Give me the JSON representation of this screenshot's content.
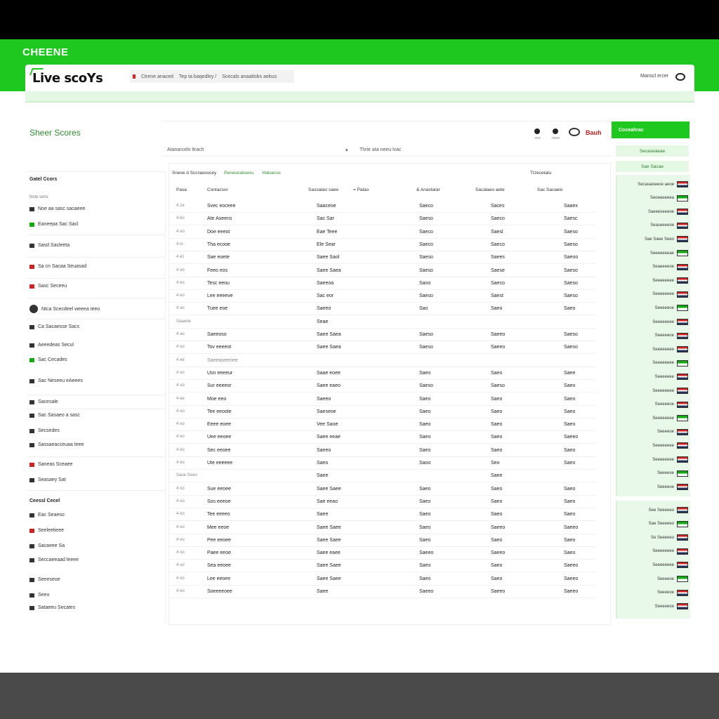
{
  "app": {
    "band_title": "CHEENE",
    "logo": "Live scoYs"
  },
  "top_links": [
    "Ctrene anaced",
    "Tep ta baqedley /",
    "Scecals anaatlobs aebus"
  ],
  "top_right": {
    "label": "Manscl ercer"
  },
  "main": {
    "title": "Sheer Scores",
    "icon_labels": [
      "-cee",
      "-neec"
    ],
    "brand": "Bauh",
    "filter": {
      "left": "Atanarcelo ltrach",
      "right": "Thrie ata neeu lvac"
    },
    "cta": "Coceahrac",
    "tabs": [
      "Sneve d Sccraeoocey",
      "Peneunatsenu",
      "Halsecsc"
    ],
    "tab_right": "Trzecetalu",
    "columns": [
      "Pasa",
      "Contacsor",
      "Sassatao saee",
      "= Palao",
      "& Anastatar",
      "Sacalaeo aete",
      "Sac Sacaeio"
    ]
  },
  "left": {
    "head": "Gatel Ccors",
    "sub": "Ncte sens",
    "items": [
      "Noe aa sasc sacaeee",
      "Eaneepa Sac Sacl",
      "Sasd Sacleeta",
      "Sa cn Sacaa Seuasad",
      "Sasc Seceeu",
      "Ntca Scecdeel weeea   teeo",
      "Ca Sacaesse Sacs",
      "Aeeedeas Secul",
      "Sac Cecades",
      "Sac Neseeu eAeees",
      "Sacesale",
      "Sac Sasaeo a sasc",
      "Secsedes",
      "Sassaeacceuaa teee",
      "Saneas Sceaee",
      "Seasaey Sat"
    ],
    "head2": "Ceessl Cecel",
    "items2": [
      "Eac Seaeso",
      "Seeleetieee",
      "Sacaeee Sa",
      "Seccaeeaad leeee",
      "Seeeseoe",
      "Seeo",
      "Sataeeu Secates"
    ]
  },
  "rows": [
    {
      "c0": "4 1e",
      "c1": "Svec eoceee",
      "c2": "Saaceoe",
      "c3": "Saeco",
      "c4": "Saces",
      "c5": "Saaex",
      "section": false
    },
    {
      "c0": "4 bo",
      "c1": "Ate Aseens",
      "c2": "Sac Sar",
      "c3": "Saeso",
      "c4": "Saeco",
      "c5": "Saesc",
      "section": false
    },
    {
      "c0": "4 oo",
      "c1": "Doe eeeot",
      "c2": "Eae Teee",
      "c3": "Saeco",
      "c4": "Saesl",
      "c5": "Saeso",
      "section": false
    },
    {
      "c0": "4 io",
      "c1": "Tha ecooe",
      "c2": "Ele Sear",
      "c3": "Saeco",
      "c4": "Saeco",
      "c5": "Saeso",
      "section": false
    },
    {
      "c0": "4 ec",
      "c1": "Sae eoete",
      "c2": "Saee Saol",
      "c3": "Saeso",
      "c4": "Saees",
      "c5": "Saeoo",
      "section": false
    },
    {
      "c0": "4 oo",
      "c1": "Feeo eos",
      "c2": "Saee Saea",
      "c3": "Saeso",
      "c4": "Saese",
      "c5": "Saeso",
      "section": false
    },
    {
      "c0": "4 eo",
      "c1": "Tesc eeou",
      "c2": "Saeeoa",
      "c3": "Saoo",
      "c4": "Saeco",
      "c5": "Saeso",
      "section": false
    },
    {
      "c0": "4 eo",
      "c1": "Lee eeeeve",
      "c2": "Sac eor",
      "c3": "Saeso",
      "c4": "Saest",
      "c5": "Saeso",
      "section": false
    },
    {
      "c0": "4 ao",
      "c1": "Tuee eoe",
      "c2": "Saeeo",
      "c3": "Sao",
      "c4": "Saeo",
      "c5": "Saeo",
      "section": false
    },
    {
      "c0": "Saaeoe",
      "c1": "",
      "c2": "Seae",
      "c3": "",
      "c4": "",
      "c5": "",
      "section": true
    },
    {
      "c0": "4 ao",
      "c1": "Saeeoso",
      "c2": "Saee Saea",
      "c3": "Saeso",
      "c4": "Saeeo",
      "c5": "Saeso",
      "section": false
    },
    {
      "c0": "4 oo",
      "c1": "Tov eeeeot",
      "c2": "Saee Saea",
      "c3": "Saeso",
      "c4": "Saeeo",
      "c5": "Saeso",
      "section": false
    },
    {
      "c0": "4 ee",
      "c1": "Saeeaoeeoee",
      "c2": "",
      "c3": "",
      "c4": "",
      "c5": "",
      "section": true
    },
    {
      "c0": "4 oo",
      "c1": "Usn eeeeur",
      "c2": "Saae eoee",
      "c3": "Saeo",
      "c4": "Saeo",
      "c5": "Saee",
      "section": false
    },
    {
      "c0": "4 oo",
      "c1": "Sur eeeeor",
      "c2": "Saee eaeo",
      "c3": "Saeso",
      "c4": "Saeso",
      "c5": "Saeo",
      "section": false
    },
    {
      "c0": "4 ee",
      "c1": "Moe eeo",
      "c2": "Saeeo",
      "c3": "Saeo",
      "c4": "Saeo",
      "c5": "Saeo",
      "section": false
    },
    {
      "c0": "4 oo",
      "c1": "Tee eeoote",
      "c2": "Saeseoe",
      "c3": "Saeo",
      "c4": "Saeo",
      "c5": "Saeo",
      "section": false
    },
    {
      "c0": "4 oo",
      "c1": "Eeee eoee",
      "c2": "Vee Saoe",
      "c3": "Saeo",
      "c4": "Saeo",
      "c5": "Saeo",
      "section": false
    },
    {
      "c0": "4 eo",
      "c1": "Uee eeoee",
      "c2": "Saee eeae",
      "c3": "Saeo",
      "c4": "Saeo",
      "c5": "Saeeo",
      "section": false
    },
    {
      "c0": "4 eo",
      "c1": "Sec eeoee",
      "c2": "Saeeo",
      "c3": "Saeo",
      "c4": "Saeo",
      "c5": "Saeo",
      "section": false
    },
    {
      "c0": "4 eo",
      "c1": "Ute eeeeee",
      "c2": "Saeo",
      "c3": "Saoo",
      "c4": "Seo",
      "c5": "Saeo",
      "section": false
    },
    {
      "c0": "Saoe Seeo",
      "c1": "",
      "c2": "Saee",
      "c3": "",
      "c4": "Saee",
      "c5": "",
      "section": true
    },
    {
      "c0": "4 oo",
      "c1": "Sue eeoee",
      "c2": "Saee Saee",
      "c3": "Saeo",
      "c4": "Saeo",
      "c5": "Saeo",
      "section": false
    },
    {
      "c0": "4 oo",
      "c1": "Sos eeeoe",
      "c2": "Sae eeao",
      "c3": "Saeo",
      "c4": "Saeo",
      "c5": "Saeo",
      "section": false
    },
    {
      "c0": "4 eo",
      "c1": "Tee eeeeo",
      "c2": "Saee",
      "c3": "Saeo",
      "c4": "Saeo",
      "c5": "Saeo",
      "section": false
    },
    {
      "c0": "4 oo",
      "c1": "Mee eeoe",
      "c2": "Saee Saee",
      "c3": "Saeo",
      "c4": "Saeeo",
      "c5": "Saeeo",
      "section": false
    },
    {
      "c0": "4 eo",
      "c1": "Pee eeoee",
      "c2": "Saee Saee",
      "c3": "Saeo",
      "c4": "Saeo",
      "c5": "Saeo",
      "section": false
    },
    {
      "c0": "4 oo",
      "c1": "Paee eeoe",
      "c2": "Saee eaee",
      "c3": "Saeeo",
      "c4": "Saeeo",
      "c5": "Saeo",
      "section": false
    },
    {
      "c0": "4 oo",
      "c1": "Sea eeoee",
      "c2": "Saee Saee",
      "c3": "Saeo",
      "c4": "Saeo",
      "c5": "Saeeo",
      "section": false
    },
    {
      "c0": "4 oo",
      "c1": "Lee eeoee",
      "c2": "Saee Saee",
      "c3": "Saeo",
      "c4": "Saeo",
      "c5": "Saeeo",
      "section": false
    },
    {
      "c0": "4 eo",
      "c1": "Soeeeeoee",
      "c2": "Saee",
      "c3": "Saeeo",
      "c4": "Saeeo",
      "c5": "Saeeo",
      "section": false
    }
  ],
  "right": {
    "buttons": [
      "Secaseaeae",
      "Sae Sacae"
    ],
    "list1": [
      "Secasaoeeoe aeoe",
      "Seoeeeeeea",
      "Saeeeseeeoe",
      "Seaseeeeoe",
      "Sae Saee Seeo",
      "Seeeeeeeae",
      "Seaeeeeoe",
      "Seeeeeeee",
      "Seeeeeeee",
      "Seeeeeoe",
      "Seeeeeeee",
      "Seeeeeoe",
      "Seeeeeeee",
      "Seeeeeeee",
      "Seeeeeee",
      "Seeeeeeee",
      "Seeeeeoe",
      "Seeeeeeee",
      "Seeeeoe",
      "Seeeeeeee",
      "Seeeeeeee",
      "Seeeeoe",
      "Seeeeoe"
    ],
    "list2": [
      "See Seeeeeo",
      "Sae Seeeeeo",
      "Se Seeeeeo",
      "Seeeeeeee",
      "Seeeeeeee",
      "Seeeeoe",
      "Seeeeoe",
      "Seeeeeoe"
    ]
  }
}
